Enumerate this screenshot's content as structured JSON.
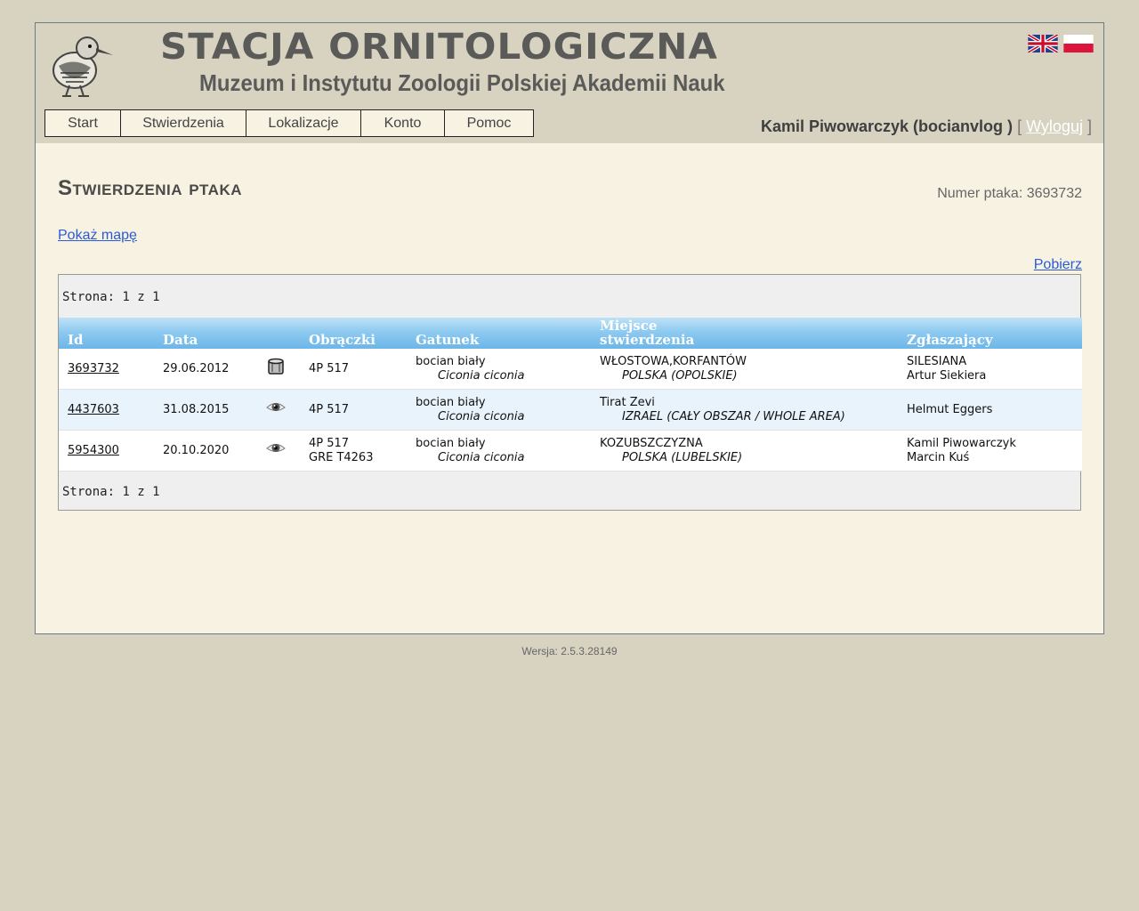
{
  "header": {
    "title": "STACJA ORNITOLOGICZNA",
    "subtitle": "Muzeum i Instytutu Zoologii Polskiej Akademii Nauk"
  },
  "nav": {
    "items": [
      {
        "label": "Start"
      },
      {
        "label": "Stwierdzenia"
      },
      {
        "label": "Lokalizacje"
      },
      {
        "label": "Konto"
      },
      {
        "label": "Pomoc"
      }
    ]
  },
  "user": {
    "name": "Kamil Piwowarczyk (bocianvlog )",
    "open_bracket": "[",
    "logout_label": "Wyloguj",
    "close_bracket": "]"
  },
  "page": {
    "title": "Stwierdzenia ptaka",
    "bird_number": "Numer ptaka: 3693732",
    "show_map": "Pokaż mapę",
    "download": "Pobierz",
    "pager_top": "Strona: 1 z 1",
    "pager_bottom": "Strona: 1 z 1"
  },
  "table": {
    "headers": {
      "id": "Id",
      "date": "Data",
      "rings": "Obrączki",
      "species": "Gatunek",
      "place_line1": "Miejsce",
      "place_line2": "stwierdzenia",
      "reporter": "Zgłaszający"
    },
    "rows": [
      {
        "id": "3693732",
        "date": "29.06.2012",
        "icon": "ring-icon",
        "rings": [
          "4P 517",
          ""
        ],
        "species": "bocian biały",
        "latin": "Ciconia ciconia",
        "place": "WŁOSTOWA,KORFANTÓW",
        "region": "POLSKA (OPOLSKIE)",
        "reporter": [
          "SILESIANA",
          "Artur Siekiera"
        ]
      },
      {
        "id": "4437603",
        "date": "31.08.2015",
        "icon": "eye-icon",
        "rings": [
          "4P 517",
          ""
        ],
        "species": "bocian biały",
        "latin": "Ciconia ciconia",
        "place": "Tirat Zevi",
        "region": "IZRAEL (CAŁY OBSZAR / WHOLE AREA)",
        "reporter": [
          "Helmut Eggers",
          ""
        ]
      },
      {
        "id": "5954300",
        "date": "20.10.2020",
        "icon": "eye-icon",
        "rings": [
          "4P 517",
          "GRE T4263"
        ],
        "species": "bocian biały",
        "latin": "Ciconia ciconia",
        "place": "KOZUBSZCZYZNA",
        "region": "POLSKA (LUBELSKIE)",
        "reporter": [
          "Kamil Piwowarczyk",
          "Marcin Kuś"
        ]
      }
    ]
  },
  "footer": {
    "version": "Wersja: 2.5.3.28149"
  },
  "colors": {
    "background": "#d8d2c0",
    "content_bg": "#f7f2e1",
    "header_row": "#8ecaf0",
    "link": "#2a5bd7"
  }
}
